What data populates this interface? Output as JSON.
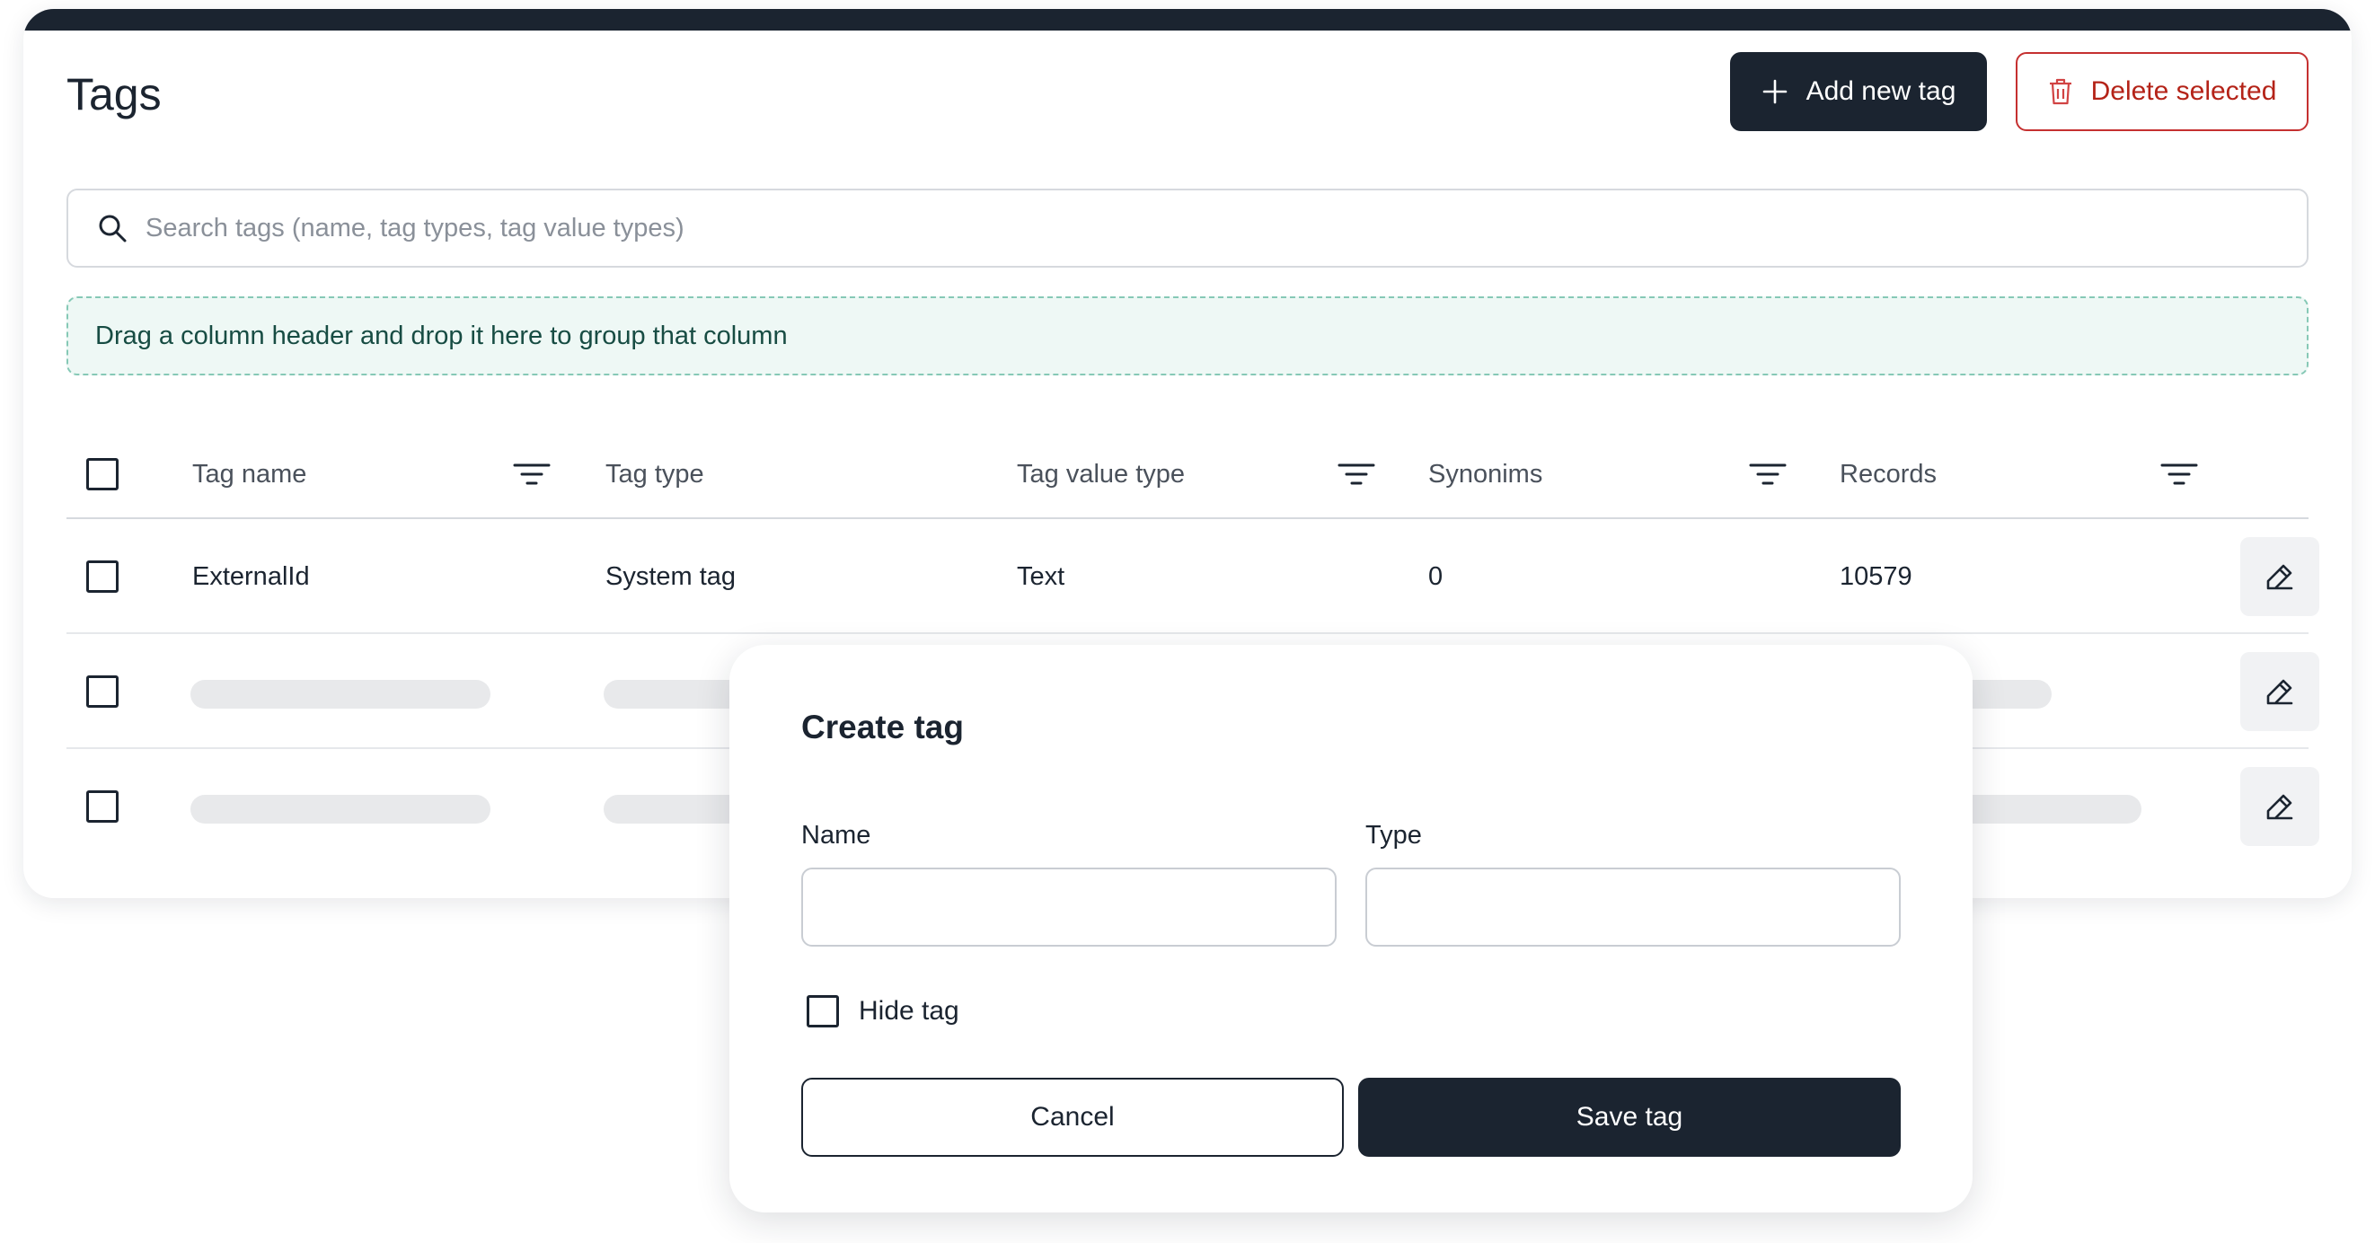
{
  "page": {
    "title": "Tags",
    "add_button_label": "Add new tag",
    "delete_button_label": "Delete selected",
    "add_icon": "plus-icon",
    "delete_icon": "trash-icon"
  },
  "search": {
    "placeholder": "Search tags (name, tag types, tag value types)",
    "value": "",
    "icon": "search-icon"
  },
  "group_zone": {
    "text": "Drag a column header and drop it here to group that column"
  },
  "table": {
    "columns": [
      {
        "label": "Tag name",
        "filterable": true
      },
      {
        "label": "Tag type",
        "filterable": false
      },
      {
        "label": "Tag value type",
        "filterable": true
      },
      {
        "label": "Synonims",
        "filterable": true
      },
      {
        "label": "Records",
        "filterable": true
      }
    ],
    "rows": [
      {
        "tag_name": "ExternalId",
        "tag_type": "System tag",
        "tag_value_type": "Text",
        "synonims": "0",
        "records": "10579",
        "loading": false
      },
      {
        "loading": true
      },
      {
        "loading": true
      }
    ],
    "edit_icon": "pencil-icon",
    "filter_icon": "filter-icon"
  },
  "modal": {
    "title": "Create tag",
    "name_label": "Name",
    "name_value": "",
    "type_label": "Type",
    "type_value": "",
    "hide_label": "Hide tag",
    "hide_checked": false,
    "cancel_label": "Cancel",
    "save_label": "Save tag"
  },
  "colors": {
    "primary": "#1b2430",
    "danger": "#b42318",
    "group_zone_bg": "#eef8f5",
    "group_zone_border": "#86c9b6"
  }
}
